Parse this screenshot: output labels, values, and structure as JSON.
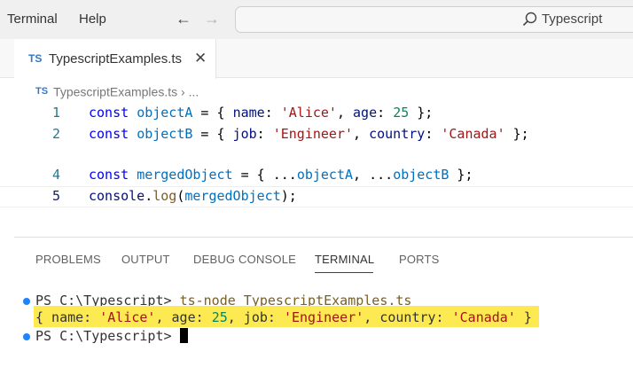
{
  "menu": {
    "terminal": "Terminal",
    "help": "Help"
  },
  "nav": {
    "back_arrow": "←",
    "forward_arrow": "→"
  },
  "search": {
    "label": "Typescript"
  },
  "tab": {
    "badge": "TS",
    "label": "TypescriptExamples.ts",
    "close": "✕"
  },
  "breadcrumb": {
    "badge": "TS",
    "file": "TypescriptExamples.ts",
    "separator": "›",
    "ellipsis": "..."
  },
  "editor": {
    "line_numbers": [
      "1",
      "2",
      "4",
      "5"
    ],
    "lines": [
      {
        "kw": "const",
        "var": "objectA",
        "eq": " = { ",
        "p1": "name",
        "c1": ": ",
        "v1": "'Alice'",
        "s1": ", ",
        "p2": "age",
        "c2": ": ",
        "v2": "25",
        "end": " };"
      },
      {
        "kw": "const",
        "var": "objectB",
        "eq": " = { ",
        "p1": "job",
        "c1": ": ",
        "v1": "'Engineer'",
        "s1": ", ",
        "p2": "country",
        "c2": ": ",
        "v2": "'Canada'",
        "end": " };"
      },
      {
        "kw": "const",
        "var": "mergedObject",
        "eq": " = { ...",
        "a": "objectA",
        "sep": ", ...",
        "b": "objectB",
        "end": " };"
      },
      {
        "obj": "console",
        "dot": ".",
        "fn": "log",
        "open": "(",
        "arg": "mergedObject",
        "close": ");"
      }
    ]
  },
  "panel": {
    "tabs": [
      "PROBLEMS",
      "OUTPUT",
      "DEBUG CONSOLE",
      "TERMINAL",
      "PORTS"
    ],
    "active_tab": "TERMINAL"
  },
  "terminal": {
    "prompt": "PS C:\\Typescript> ",
    "command": "ts-node TypescriptExamples.ts",
    "output": {
      "o1": "{ name: ",
      "v1": "'Alice'",
      "o2": ", age: ",
      "v2": "25",
      "o3": ", job: ",
      "v3": "'Engineer'",
      "o4": ", country: ",
      "v4": "'Canada'",
      "o5": " }"
    },
    "prompt2": "PS C:\\Typescript> "
  },
  "colors": {
    "accent": "#3178c6",
    "highlight": "#fde951",
    "terminal_dot": "#1a85ff"
  }
}
